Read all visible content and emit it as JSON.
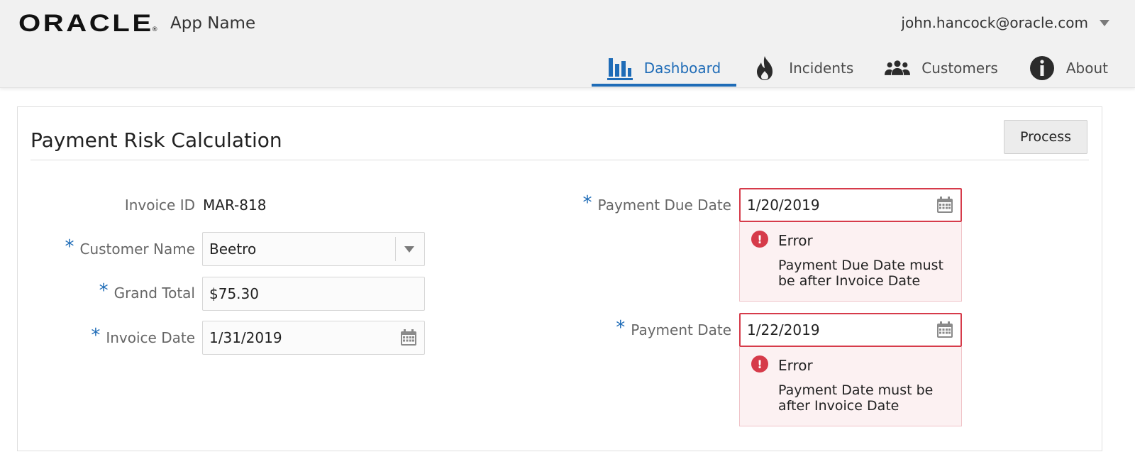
{
  "header": {
    "logo_text": "ORACLE",
    "logo_mark": "®",
    "app_name": "App Name",
    "user_email": "john.hancock@oracle.com"
  },
  "nav": {
    "items": [
      {
        "label": "Dashboard",
        "icon": "bar-chart-icon",
        "active": true
      },
      {
        "label": "Incidents",
        "icon": "fire-icon",
        "active": false
      },
      {
        "label": "Customers",
        "icon": "people-icon",
        "active": false
      },
      {
        "label": "About",
        "icon": "info-icon",
        "active": false
      }
    ]
  },
  "form": {
    "title": "Payment Risk Calculation",
    "process_label": "Process",
    "required_mark": "*",
    "invoice_id_label": "Invoice ID",
    "invoice_id_value": "MAR-818",
    "customer_name_label": "Customer Name",
    "customer_name_value": "Beetro",
    "grand_total_label": "Grand Total",
    "grand_total_value": "$75.30",
    "invoice_date_label": "Invoice Date",
    "invoice_date_value": "1/31/2019",
    "payment_due_date_label": "Payment Due Date",
    "payment_due_date_value": "1/20/2019",
    "payment_due_date_error_title": "Error",
    "payment_due_date_error_msg": "Payment Due Date must be after Invoice Date",
    "payment_date_label": "Payment Date",
    "payment_date_value": "1/22/2019",
    "payment_date_error_title": "Error",
    "payment_date_error_msg": "Payment Date must be after Invoice Date",
    "error_color": "#d63b4a",
    "accent_color": "#1f6cb7"
  }
}
